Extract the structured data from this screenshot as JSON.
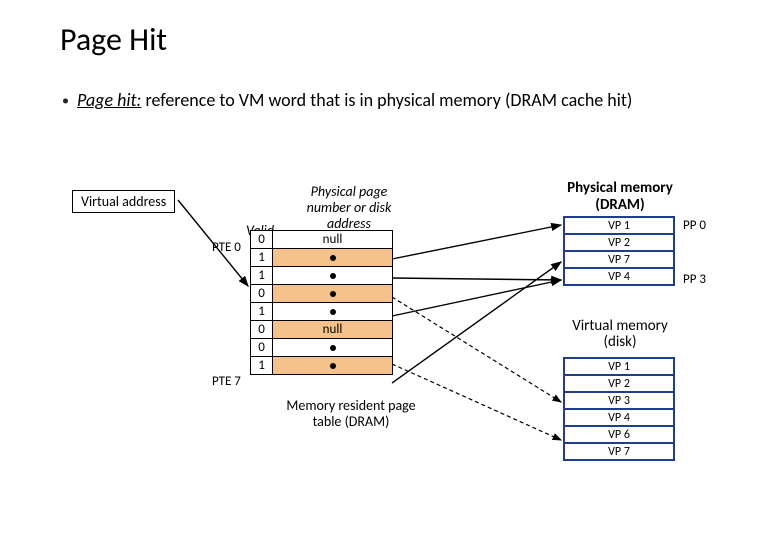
{
  "title": "Page Hit",
  "bullet": {
    "emph": "Page hit:",
    "rest": " reference to VM word that is in physical memory (DRAM cache hit)"
  },
  "virtual_address_label": "Virtual address",
  "page_table": {
    "header_valid": "Valid",
    "header_ppn": "Physical page number or disk address",
    "left_label_top": "PTE 0",
    "left_label_bot": "PTE 7",
    "rows": [
      {
        "valid": "0",
        "pp": "null",
        "dot": false,
        "hi": false
      },
      {
        "valid": "1",
        "pp": "",
        "dot": true,
        "hi": true
      },
      {
        "valid": "1",
        "pp": "",
        "dot": true,
        "hi": false
      },
      {
        "valid": "0",
        "pp": "",
        "dot": true,
        "hi": true
      },
      {
        "valid": "1",
        "pp": "",
        "dot": true,
        "hi": false
      },
      {
        "valid": "0",
        "pp": "null",
        "dot": false,
        "hi": true
      },
      {
        "valid": "0",
        "pp": "",
        "dot": true,
        "hi": false
      },
      {
        "valid": "1",
        "pp": "",
        "dot": true,
        "hi": true
      }
    ],
    "caption": "Memory resident page table (DRAM)"
  },
  "phys_mem": {
    "title": "Physical memory (DRAM)",
    "rows": [
      "VP 1",
      "VP 2",
      "VP 7",
      "VP 4"
    ],
    "pp_labels": {
      "0": "PP 0",
      "3": "PP 3"
    }
  },
  "virt_mem_disk": {
    "title": "Virtual memory (disk)",
    "rows": [
      "VP 1",
      "VP 2",
      "VP 3",
      "VP 4",
      "VP 6",
      "VP 7"
    ]
  }
}
